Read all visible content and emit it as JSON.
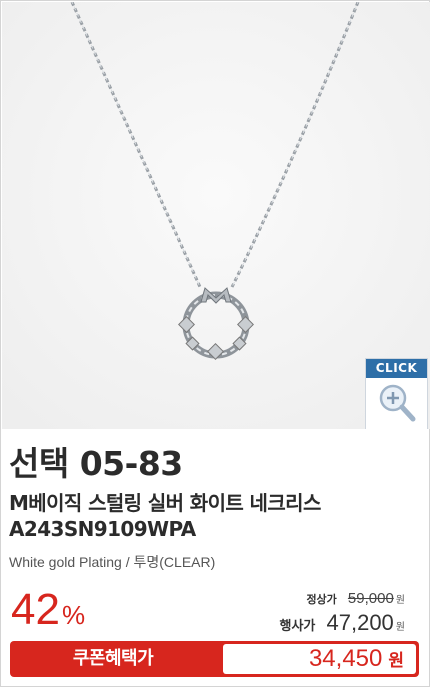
{
  "product": {
    "code_title": "선택 05-83",
    "name": "M베이직 스털링 실버 화이트 네크리스",
    "model": "A243SN9109WPA",
    "option": "White gold Plating / 투명(CLEAR)"
  },
  "zoom_badge": {
    "label": "CLICK",
    "icon": "magnifier-plus-icon"
  },
  "pricing": {
    "discount_rate": "42",
    "discount_symbol": "%",
    "regular_label": "정상가",
    "regular_price": "59,000",
    "regular_unit": "원",
    "sale_label": "행사가",
    "sale_price": "47,200",
    "sale_unit": "원"
  },
  "coupon": {
    "label": "쿠폰혜택가",
    "price": "34,450",
    "unit": "원"
  },
  "colors": {
    "accent_red": "#d7261e",
    "badge_blue": "#2e6fa8",
    "image_bg": "#f5f5f5"
  }
}
